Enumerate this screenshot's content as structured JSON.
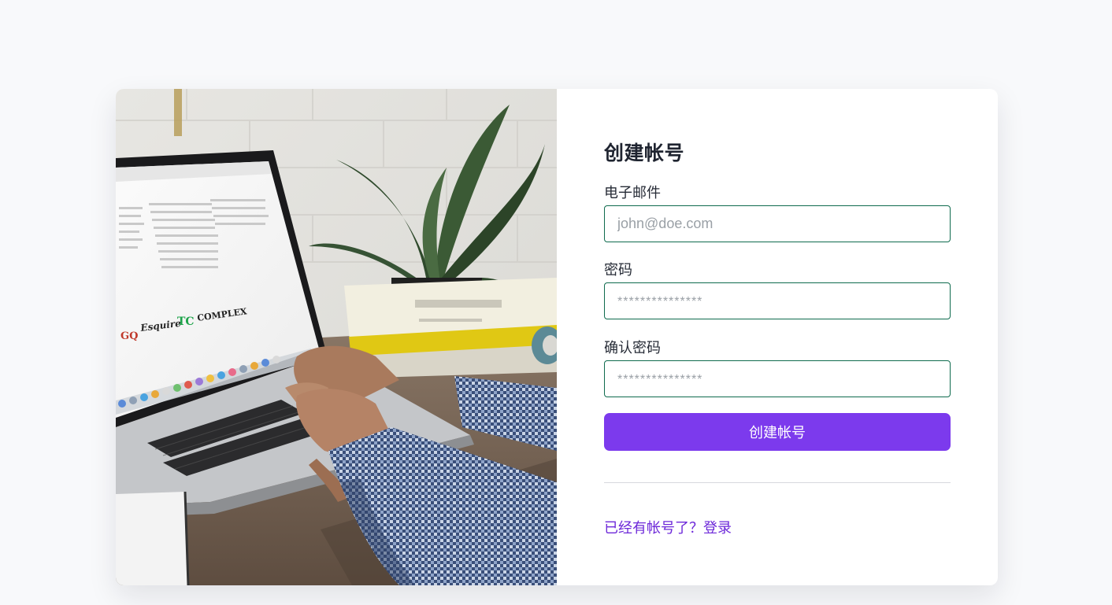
{
  "signup": {
    "title": "创建帐号",
    "email": {
      "label": "电子邮件",
      "placeholder": "john@doe.com",
      "value": ""
    },
    "password": {
      "label": "密码",
      "placeholder": "***************",
      "value": ""
    },
    "confirm_password": {
      "label": "确认密码",
      "placeholder": "***************",
      "value": ""
    },
    "submit_label": "创建帐号",
    "signin_link": "已经有帐号了？登录"
  },
  "photo": {
    "logos": [
      "GQ",
      "Esquire",
      "TC",
      "COMPLEX"
    ]
  },
  "colors": {
    "page_background": "#f8f9fb",
    "accent": "#7c3aed",
    "link": "#6d28d9",
    "field_border": "#0f6b4e"
  }
}
